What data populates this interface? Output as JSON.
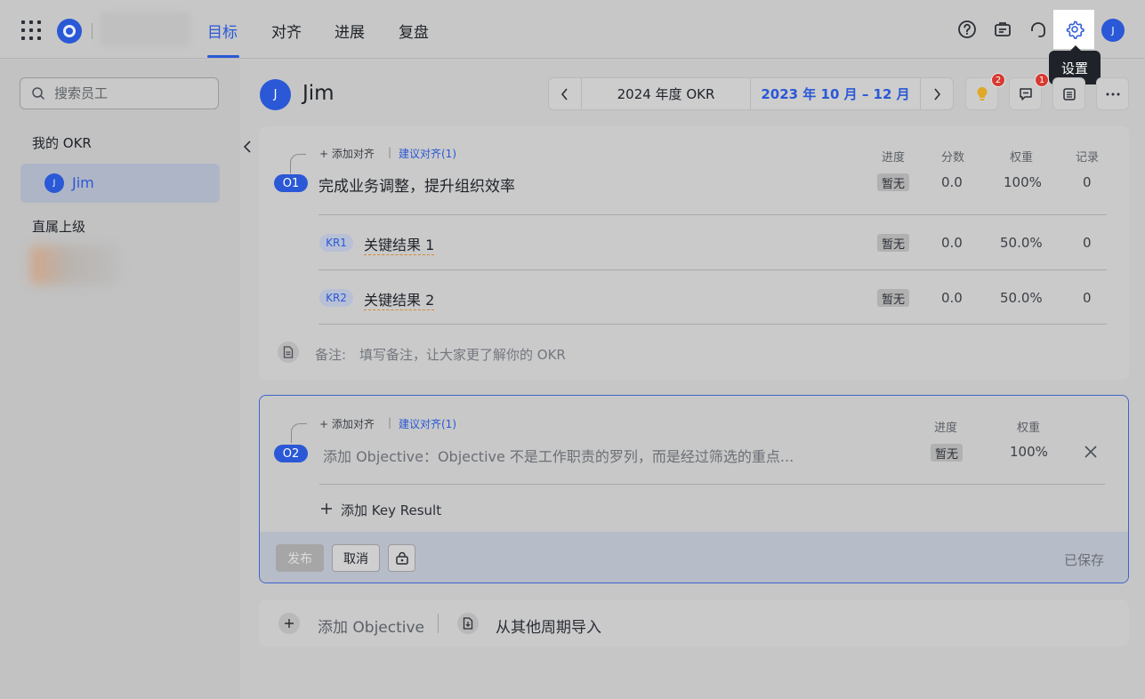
{
  "topbar": {
    "nav_tabs": [
      {
        "label": "目标",
        "active": true
      },
      {
        "label": "对齐",
        "active": false
      },
      {
        "label": "进展",
        "active": false
      },
      {
        "label": "复盘",
        "active": false
      }
    ],
    "user_initial": "J",
    "settings_tooltip": "设置"
  },
  "sidebar": {
    "search_placeholder": "搜索员工",
    "my_okr_label": "我的 OKR",
    "my_user": {
      "initial": "J",
      "name": "Jim"
    },
    "superior_label": "直属上级"
  },
  "header": {
    "user_initial": "J",
    "user_name": "Jim",
    "year_label": "2024 年度 OKR",
    "quarter_label": "2023 年 10 月 – 12 月",
    "badges": {
      "ideas": "2",
      "comments": "1"
    }
  },
  "objective1": {
    "add_align": "+ 添加对齐",
    "suggest_align": "建议对齐(1)",
    "pill": "O1",
    "title": "完成业务调整，提升组织效率",
    "columns": {
      "progress": "进度",
      "score": "分数",
      "weight": "权重",
      "records": "记录"
    },
    "progress": "暂无",
    "score": "0.0",
    "weight": "100%",
    "records": "0",
    "key_results": [
      {
        "pill": "KR1",
        "title": "关键结果 1",
        "progress": "暂无",
        "score": "0.0",
        "weight": "50.0%",
        "records": "0"
      },
      {
        "pill": "KR2",
        "title": "关键结果 2",
        "progress": "暂无",
        "score": "0.0",
        "weight": "50.0%",
        "records": "0"
      }
    ],
    "note_label": "备注:",
    "note_placeholder": "填写备注，让大家更了解你的 OKR"
  },
  "objective2": {
    "add_align": "+ 添加对齐",
    "suggest_align": "建议对齐(1)",
    "pill": "O2",
    "placeholder": "添加 Objective：Objective 不是工作职责的罗列，而是经过筛选的重点...",
    "columns": {
      "progress": "进度",
      "weight": "权重"
    },
    "progress": "暂无",
    "weight": "100%",
    "add_kr": "添加 Key Result",
    "publish": "发布",
    "cancel": "取消",
    "saved": "已保存"
  },
  "bottom": {
    "add_objective": "添加 Objective",
    "import": "从其他周期导入"
  },
  "colors": {
    "accent": "#2a58d6",
    "badge": "#d83931"
  }
}
